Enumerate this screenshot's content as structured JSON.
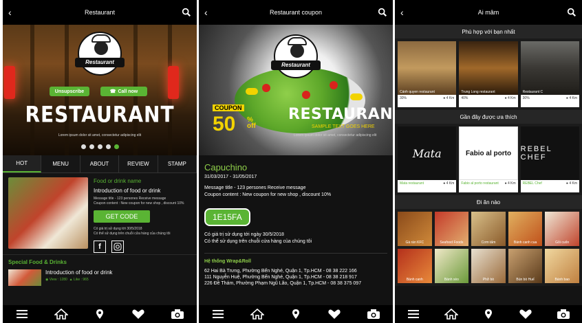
{
  "screens": {
    "restaurant": {
      "title": "Restaurant",
      "hero": {
        "logo_text": "Restaurant",
        "unsubscribe_label": "Unsupscribe",
        "call_label": "Call now",
        "headline": "RESTAURANT",
        "subtext": "Lorem ipsum dolor sit amet, consectetur adipiscing elit"
      },
      "tabs": [
        "HOT",
        "MENU",
        "ABOUT",
        "REVIEW",
        "STAMP"
      ],
      "featured": {
        "name": "Food or drink name",
        "intro": "Introduction of food or drink",
        "message": "Message title - 123 persones Receive message",
        "coupon": "Coupon content : New coupon for new shop , discount 10%",
        "get_code_label": "GET CODE",
        "valid_text": "Có giá trị sử dụng tới 30/5/2018",
        "chain_text": "Có thể sử dụng trên chuỗi cửa hàng của chúng tôi"
      },
      "special_title": "Special Food & Drinks",
      "special_item": {
        "title": "Introduction of food or drink",
        "views": "View : 1280",
        "likes": "Like : 965"
      }
    },
    "coupon": {
      "title": "Restaurant coupon",
      "banner": {
        "logo_text": "Restaurant",
        "coupon_label": "COUPON",
        "percent": "50",
        "percent_sign": "%",
        "off_label": "off",
        "headline": "RESTAURANT",
        "sample_text": "SAMPLE TEXT GOES HERE",
        "lorem": "Lorem ipsum dolor sit amet, consectetur adipiscing elit"
      },
      "name": "Capuchino",
      "date_range": "31/03/2017 - 31/05/2017",
      "message": "Message title - 123 persones Receive message",
      "content": "Coupon content : New coupon for new shop , discount 10%",
      "code": "1E15FA",
      "valid_text": "Có giá trị sử dụng tới ngày 30/5/2018",
      "chain_text": "Có thể sử dụng trên chuỗi cửa hàng của chúng tôi",
      "system_title": "Hệ thống Wrap&Roll",
      "addresses": [
        "62 Hai Bà Trưng, Phường Bến Nghé, Quận 1, Tp.HCM - 08 38 222 166",
        "111 Nguyễn Huệ, Phường Bến Nghé, Quận 1, Tp.HCM - 08 38 218 917",
        "226 Đề Thám, Phường Phạm Ngũ Lão, Quận 1, Tp.HCM - 08 38 375 097"
      ]
    },
    "ai_mam": {
      "title": "Ai mâm",
      "section1_title": "Phù hợp với bạn nhất",
      "section1_cards": [
        {
          "name": "Cánh quyen restaurant",
          "pct": "30%",
          "dist": "4 Km"
        },
        {
          "name": "Trung Long restaurant",
          "pct": "40%",
          "dist": "4 Km"
        },
        {
          "name": "Restaurant C",
          "pct": "30%",
          "dist": "4 Km"
        }
      ],
      "section2_title": "Gần đây được ưa thích",
      "section2_cards": [
        {
          "name": "Mata restaurant",
          "brand": "Mata",
          "dist": "4 Km"
        },
        {
          "name": "Fabio al porto restaurant",
          "brand": "Fabio al porto",
          "dist": "4 Km"
        },
        {
          "name": "REBEL Chef",
          "brand": "REBEL CHEF",
          "dist": "4 Km"
        }
      ],
      "section3_title": "Đi ăn nào",
      "section3_items": [
        "Gà rán KFC",
        "Seafood Foods",
        "Cơm tấm",
        "Bánh canh cua",
        "Gỏi cuốn",
        "Bánh canh",
        "Bánh xèo",
        "Phở bò",
        "Bún bò Huế",
        "Bánh bao"
      ]
    }
  },
  "colors": {
    "accent": "#5ab434",
    "dark": "#141414",
    "yellow": "#f2d300"
  },
  "bottom_nav_icons": [
    "menu-icon",
    "home-icon",
    "location-icon",
    "heart-icon",
    "camera-icon"
  ]
}
